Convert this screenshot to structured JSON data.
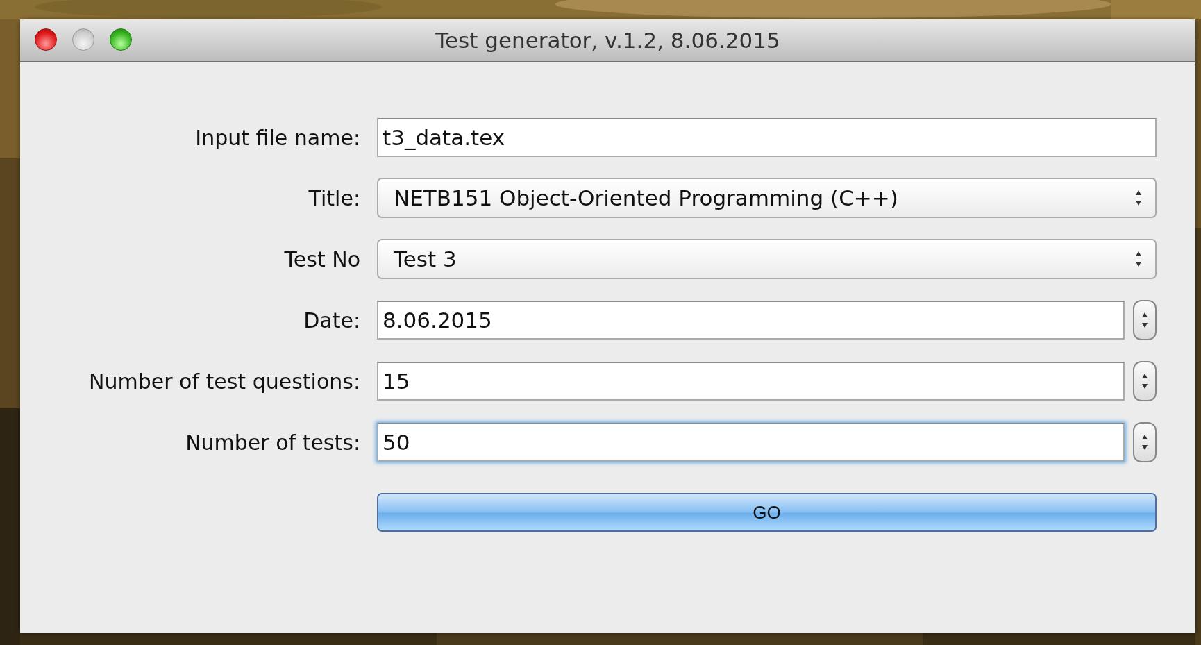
{
  "window": {
    "title": "Test generator, v.1.2, 8.06.2015",
    "controls": [
      {
        "kind": "close",
        "disabled": false
      },
      {
        "kind": "minimize",
        "disabled": true
      },
      {
        "kind": "zoom",
        "disabled": false
      }
    ]
  },
  "form": {
    "fields": [
      {
        "kind": "text",
        "label": "Input file name:",
        "value": "t3_data.tex",
        "focused": false
      },
      {
        "kind": "select",
        "label": "Title:",
        "value": "NETB151 Object-Oriented Programming (C++)",
        "focused": false
      },
      {
        "kind": "select",
        "label": "Test No",
        "value": "Test 3",
        "focused": false
      },
      {
        "kind": "spinner",
        "label": "Date:",
        "value": "8.06.2015",
        "focused": false
      },
      {
        "kind": "spinner",
        "label": "Number of test questions:",
        "value": "15",
        "focused": false
      },
      {
        "kind": "spinner",
        "label": "Number of tests:",
        "value": "50",
        "focused": true
      }
    ],
    "button": "GO"
  }
}
